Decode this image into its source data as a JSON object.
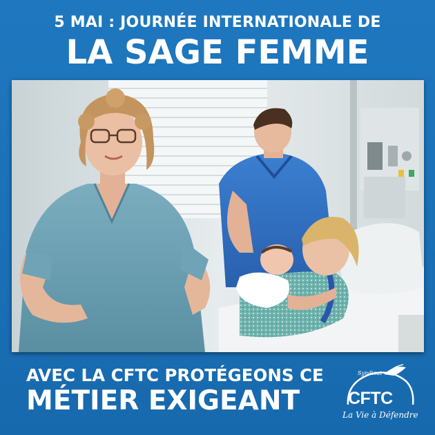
{
  "headline": {
    "line1": "5 MAI : JOURNÉE INTERNATIONALE DE",
    "line2": "LA SAGE FEMME"
  },
  "footer": {
    "line1": "AVEC LA CFTC PROTÉGEONS CE",
    "line2": "MÉTIER EXIGEANT"
  },
  "logo": {
    "small_text": "Syndicat",
    "name": "CFTC",
    "tagline": "La Vie à Défendre"
  },
  "colors": {
    "background": "#1a6fb5",
    "text": "#ffffff",
    "scrubs": "#6aa0b2",
    "polo": "#2e6fc4"
  }
}
